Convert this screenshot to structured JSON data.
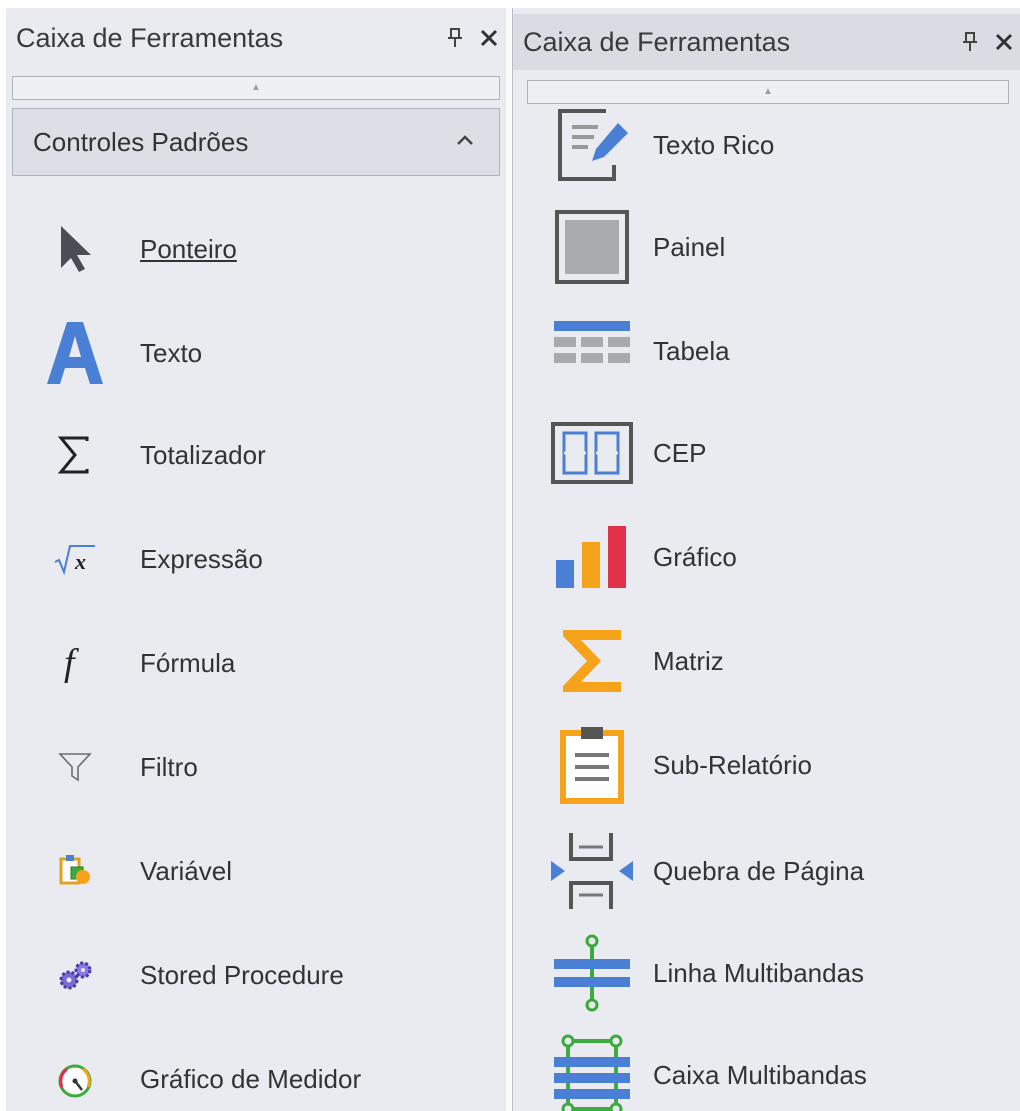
{
  "left_panel": {
    "title": "Caixa de Ferramentas",
    "group": {
      "label": "Controles Padrões",
      "expanded": true
    },
    "items": [
      {
        "label": "Ponteiro",
        "icon": "pointer-arrow-icon"
      },
      {
        "label": "Texto",
        "icon": "text-a-icon"
      },
      {
        "label": "Totalizador",
        "icon": "sigma-icon"
      },
      {
        "label": "Expressão",
        "icon": "sqrt-x-icon"
      },
      {
        "label": "Fórmula",
        "icon": "function-f-icon"
      },
      {
        "label": "Filtro",
        "icon": "filter-funnel-icon"
      },
      {
        "label": "Variável",
        "icon": "variable-icon"
      },
      {
        "label": "Stored Procedure",
        "icon": "stored-procedure-gear-icon"
      },
      {
        "label": "Gráfico de Medidor",
        "icon": "gauge-icon"
      }
    ]
  },
  "right_panel": {
    "title": "Caixa de Ferramentas",
    "items": [
      {
        "label": "Texto Rico",
        "icon": "rich-text-icon"
      },
      {
        "label": "Painel",
        "icon": "panel-icon"
      },
      {
        "label": "Tabela",
        "icon": "table-icon"
      },
      {
        "label": "CEP",
        "icon": "zip-code-icon"
      },
      {
        "label": "Gráfico",
        "icon": "bar-chart-icon"
      },
      {
        "label": "Matriz",
        "icon": "matrix-sigma-icon"
      },
      {
        "label": "Sub-Relatório",
        "icon": "sub-report-clipboard-icon"
      },
      {
        "label": "Quebra de Página",
        "icon": "page-break-icon"
      },
      {
        "label": "Linha Multibandas",
        "icon": "multiband-line-icon"
      },
      {
        "label": "Caixa Multibandas",
        "icon": "multiband-box-icon"
      }
    ]
  },
  "colors": {
    "panel_bg": "#e9ebf0",
    "accent_blue": "#4a7fd6",
    "accent_orange": "#f5a31a",
    "accent_red": "#e0304a",
    "green": "#3caa3c"
  }
}
